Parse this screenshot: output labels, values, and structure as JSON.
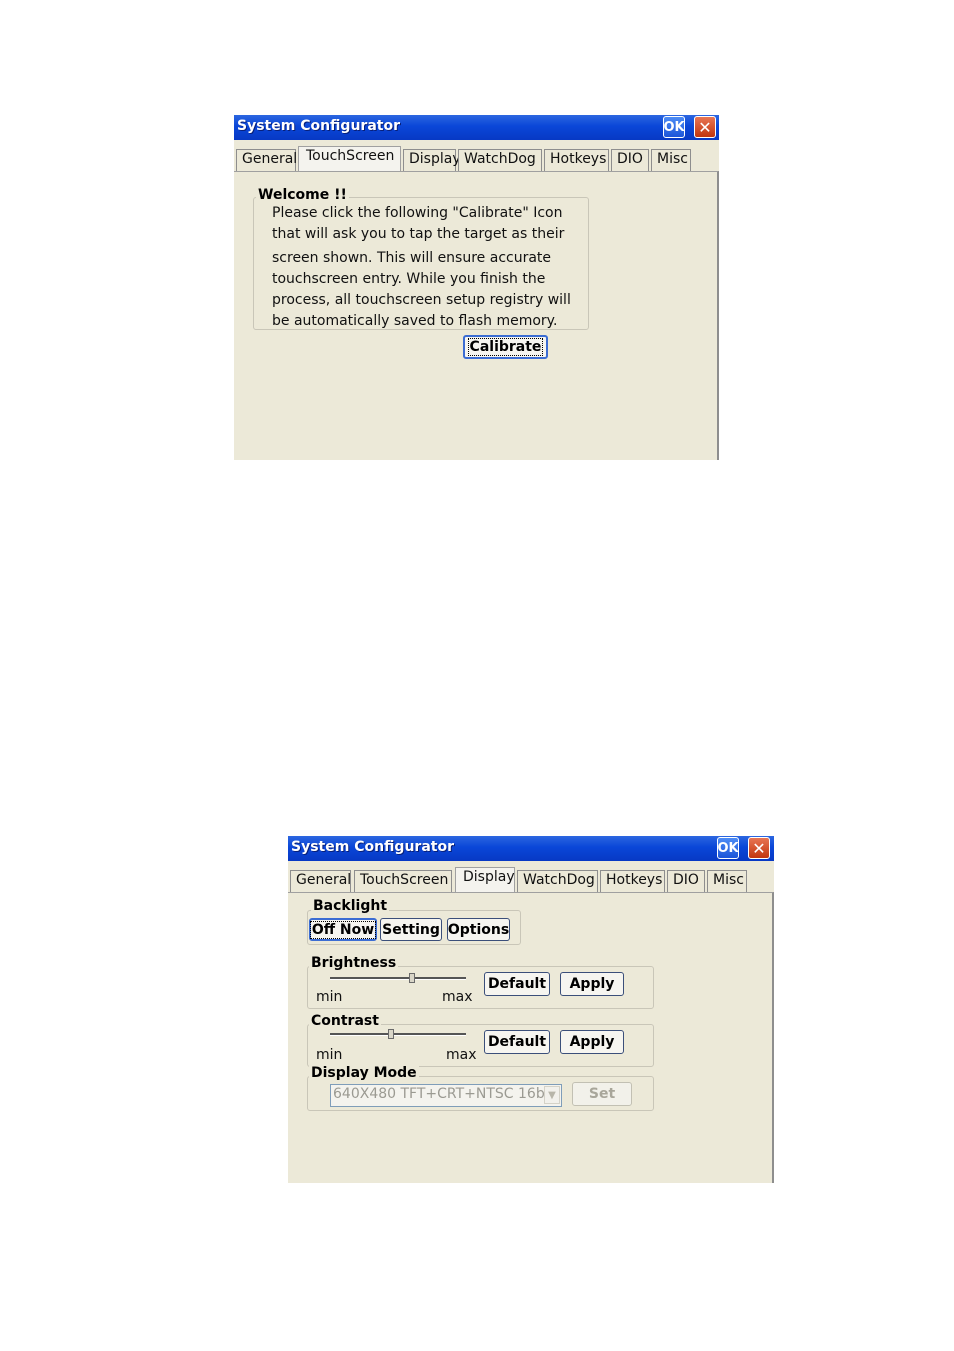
{
  "window1": {
    "title": "System Configurator",
    "ok_label": "OK",
    "close_label": "✕",
    "tabs": [
      "General",
      "TouchScreen",
      "Display",
      "WatchDog",
      "Hotkeys",
      "DIO",
      "Misc"
    ],
    "active_tab": "TouchScreen",
    "welcome_heading": "Welcome !!",
    "welcome_lines": [
      "Please click the following \"Calibrate\" Icon",
      "that will ask you to tap the target as their",
      "screen shown. This will ensure accurate",
      "touchscreen entry. While you finish the",
      "process, all touchscreen setup registry will",
      "be automatically saved to flash memory."
    ],
    "calibrate_label": "Calibrate"
  },
  "window2": {
    "title": "System Configurator",
    "ok_label": "OK",
    "close_label": "✕",
    "tabs": [
      "General",
      "TouchScreen",
      "Display",
      "WatchDog",
      "Hotkeys",
      "DIO",
      "Misc"
    ],
    "active_tab": "Display",
    "backlight": {
      "label": "Backlight",
      "off_now": "Off Now",
      "setting": "Setting",
      "options": "Options"
    },
    "brightness": {
      "label": "Brightness",
      "min": "min",
      "max": "max",
      "level": 0.6,
      "default_label": "Default",
      "apply_label": "Apply"
    },
    "contrast": {
      "label": "Contrast",
      "min": "min",
      "max": "max",
      "level": 0.45,
      "default_label": "Default",
      "apply_label": "Apply"
    },
    "display_mode": {
      "label": "Display Mode",
      "selected": "640X480 TFT+CRT+NTSC 16b",
      "set_label": "Set"
    }
  }
}
